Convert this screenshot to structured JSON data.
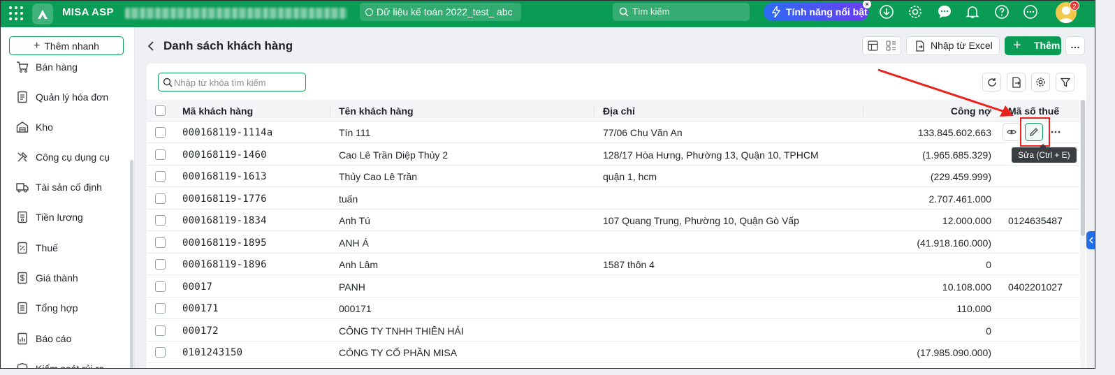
{
  "app": {
    "brand": "MISA ASP",
    "database": "Dữ liệu kế toán 2022_test_ abc",
    "search_placeholder": "Tìm kiếm",
    "feature_button": "Tính năng nổi bật",
    "notification_count": "2"
  },
  "sidebar": {
    "quick_add": "Thêm nhanh",
    "items": [
      {
        "label": "Bán hàng",
        "icon": "cart-icon"
      },
      {
        "label": "Quản lý hóa đơn",
        "icon": "invoice-icon"
      },
      {
        "label": "Kho",
        "icon": "warehouse-icon"
      },
      {
        "label": "Công cụ dụng cụ",
        "icon": "tools-icon"
      },
      {
        "label": "Tài sản cố định",
        "icon": "truck-icon"
      },
      {
        "label": "Tiền lương",
        "icon": "payroll-icon"
      },
      {
        "label": "Thuế",
        "icon": "tax-icon"
      },
      {
        "label": "Giá thành",
        "icon": "cost-icon"
      },
      {
        "label": "Tổng hợp",
        "icon": "summary-icon"
      },
      {
        "label": "Báo cáo",
        "icon": "report-icon"
      },
      {
        "label": "Kiểm soát rủi ro",
        "icon": "risk-icon"
      }
    ]
  },
  "page": {
    "title": "Danh sách khách hàng",
    "import_excel": "Nhập từ Excel",
    "add": "Thêm",
    "search_placeholder": "Nhập từ khóa tìm kiếm"
  },
  "table": {
    "columns": [
      "Mã khách hàng",
      "Tên khách hàng",
      "Địa chỉ",
      "Công nợ",
      "Mã số thuế"
    ],
    "rows": [
      {
        "code": "000168119-1114a",
        "name": "Tín 111",
        "address": "77/06 Chu Văn An",
        "debt": "133.845.602.663",
        "tax": "",
        "negative": false
      },
      {
        "code": "000168119-1460",
        "name": "Cao Lê Trần Diệp Thủy 2",
        "address": "128/17 Hòa Hưng, Phường 13, Quận 10, TPHCM",
        "debt": "(1.965.685.329)",
        "tax": "",
        "negative": true
      },
      {
        "code": "000168119-1613",
        "name": "Thủy Cao Lê Trần",
        "address": "quận 1, hcm",
        "debt": "(229.459.999)",
        "tax": "",
        "negative": true
      },
      {
        "code": "000168119-1776",
        "name": "tuấn",
        "address": "",
        "debt": "2.707.461.000",
        "tax": "",
        "negative": false
      },
      {
        "code": "000168119-1834",
        "name": "Anh Tú",
        "address": "107 Quang Trung, Phường 10, Quận Gò Vấp",
        "debt": "12.000.000",
        "tax": "0124635487",
        "negative": false
      },
      {
        "code": "000168119-1895",
        "name": "ANH Á",
        "address": "",
        "debt": "(41.918.160.000)",
        "tax": "",
        "negative": true
      },
      {
        "code": "000168119-1896",
        "name": "Anh Lâm",
        "address": "1587 thôn 4",
        "debt": "0",
        "tax": "",
        "negative": false
      },
      {
        "code": "00017",
        "name": "PANH",
        "address": "",
        "debt": "10.108.000",
        "tax": "0402201027",
        "negative": false
      },
      {
        "code": "000171",
        "name": "000171",
        "address": "",
        "debt": "110.000",
        "tax": "",
        "negative": false
      },
      {
        "code": "000172",
        "name": "CÔNG TY TNHH THIÊN HẢI",
        "address": "",
        "debt": "0",
        "tax": "",
        "negative": false
      },
      {
        "code": "0101243150",
        "name": "CÔNG TY CỔ PHẦN MISA",
        "address": "",
        "debt": "(17.985.090.000)",
        "tax": "",
        "negative": true
      }
    ]
  },
  "tooltip": "Sửa (Ctrl + E)",
  "colors": {
    "brand_green": "#0a9b55",
    "negative_red": "#e53935",
    "annotation_red": "#e8231d"
  }
}
